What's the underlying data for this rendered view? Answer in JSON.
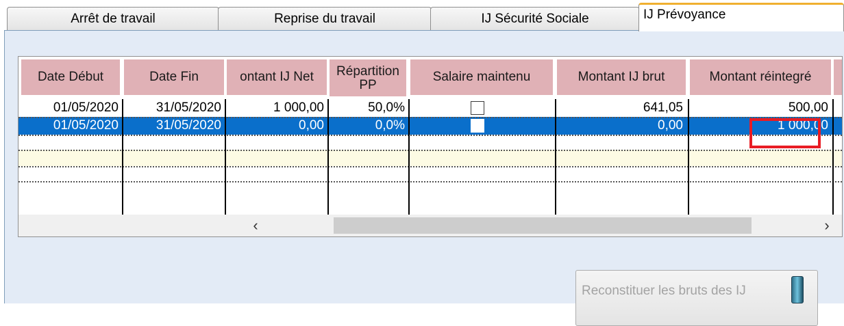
{
  "tabs": [
    {
      "label": "Arrêt de travail"
    },
    {
      "label": "Reprise du travail"
    },
    {
      "label": "IJ Sécurité Sociale"
    },
    {
      "label": "IJ Prévoyance",
      "active": true
    }
  ],
  "grid": {
    "columns": [
      "Date Début",
      "Date Fin",
      "ontant IJ Net",
      "Répartition PP",
      "Salaire maintenu",
      "Montant IJ brut",
      "Montant réintegré"
    ],
    "rows": [
      {
        "date_debut": "01/05/2020",
        "date_fin": "31/05/2020",
        "montant_ij_net": "1 000,00",
        "repartition_pp": "50,0%",
        "salaire_maintenu": false,
        "montant_ij_brut": "641,05",
        "montant_reintegre": "500,00",
        "selected": false
      },
      {
        "date_debut": "01/05/2020",
        "date_fin": "31/05/2020",
        "montant_ij_net": "0,00",
        "repartition_pp": "0,0%",
        "salaire_maintenu": false,
        "montant_ij_brut": "0,00",
        "montant_reintegre": "1 000,00",
        "selected": true
      }
    ],
    "scroll_left_icon": "chevron-left-icon",
    "scroll_right_icon": "chevron-right-icon"
  },
  "highlight_color": "#e81c24",
  "selection_color": "#0a6fcb",
  "header_color": "#e0b1b6",
  "button": {
    "label": "Reconstituer les bruts des IJ",
    "icon": "phone-icon",
    "enabled": false
  }
}
